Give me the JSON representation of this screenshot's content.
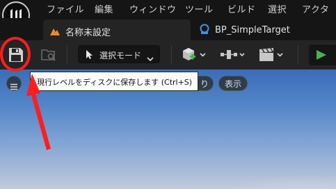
{
  "menubar": {
    "items": [
      "ファイル",
      "編集",
      "ウィンドウ",
      "ツール",
      "ビルド",
      "選択",
      "アクタ"
    ]
  },
  "tabs": [
    {
      "label": "名称未設定"
    },
    {
      "label": "BP_SimpleTarget"
    }
  ],
  "toolbar": {
    "mode_label": "選択モード"
  },
  "viewport": {
    "pill_partial": "り",
    "show_label": "表示"
  },
  "tooltip": {
    "text": "現行レベルをディスクに保存します (Ctrl+S)"
  },
  "colors": {
    "annotation": "#ff1d1d",
    "play": "#4bb34b",
    "level_icon": "#f08a24",
    "blueprint_icon": "#4a8fe0"
  },
  "icons": [
    "unreal-logo-icon",
    "level-icon",
    "blueprint-icon",
    "save-icon",
    "browse-icon",
    "select-mode-icon",
    "add-actor-icon",
    "blueprint-menu-icon",
    "cinematics-icon",
    "chevron-down-icon",
    "play-icon",
    "hamburger-icon",
    "arrow-annotation-icon"
  ]
}
